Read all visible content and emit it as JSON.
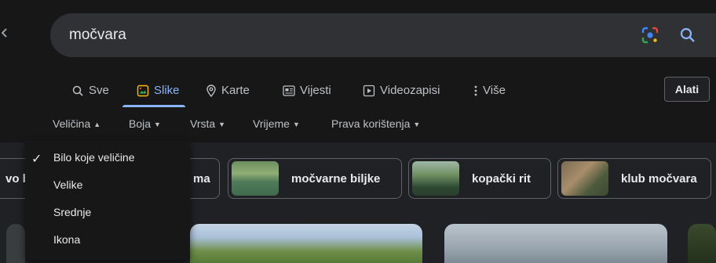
{
  "search": {
    "query": "močvara"
  },
  "tabs": [
    {
      "label": "Sve",
      "icon": "search-icon"
    },
    {
      "label": "Slike",
      "icon": "image-icon",
      "active": true
    },
    {
      "label": "Karte",
      "icon": "location-pin-icon"
    },
    {
      "label": "Vijesti",
      "icon": "news-icon"
    },
    {
      "label": "Videozapisi",
      "icon": "play-icon"
    },
    {
      "label": "Više",
      "icon": "more-vert-icon"
    }
  ],
  "tools_button": "Alati",
  "filters": [
    "Veličina",
    "Boja",
    "Vrsta",
    "Vrijeme",
    "Prava korištenja"
  ],
  "size_menu": {
    "items": [
      "Bilo koje veličine",
      "Velike",
      "Srednje",
      "Ikona"
    ],
    "selected": "Bilo koje veličine"
  },
  "chips": [
    {
      "label": "vo b"
    },
    {
      "label": "ma"
    },
    {
      "label": "močvarne biljke"
    },
    {
      "label": "kopački rit"
    },
    {
      "label": "klub močvara"
    }
  ],
  "colors": {
    "accent": "#8ab4f8",
    "background": "#202124",
    "bar": "#171717"
  }
}
